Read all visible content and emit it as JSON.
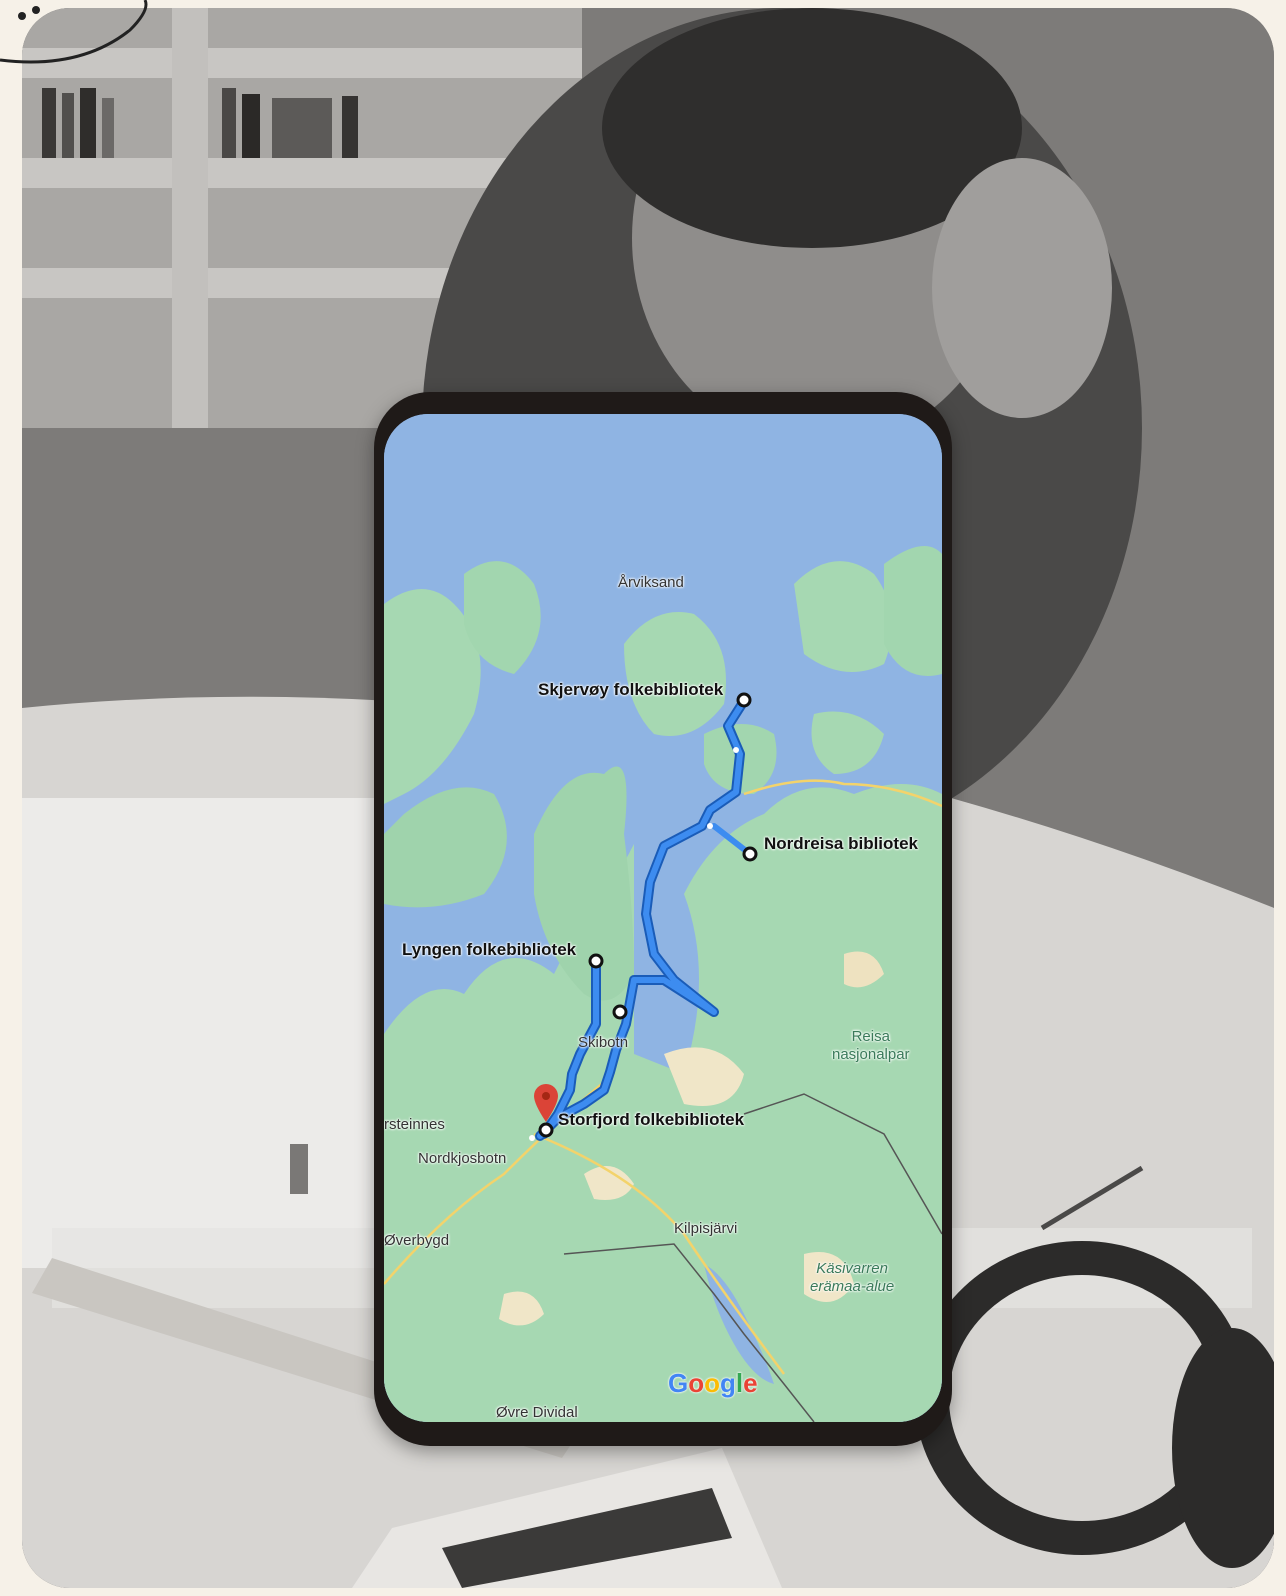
{
  "map": {
    "libraries": [
      {
        "id": "skjervoy",
        "label": "Skjervøy folkebibliotek"
      },
      {
        "id": "nordreisa",
        "label": "Nordreisa bibliotek"
      },
      {
        "id": "lyngen",
        "label": "Lyngen folkebibliotek"
      },
      {
        "id": "storfjord",
        "label": "Storfjord folkebibliotek"
      }
    ],
    "places": {
      "arviksand": "Årviksand",
      "skibotn": "Skibotn",
      "olderdalen_partial": "rsteinnes",
      "nordkjosbotn": "Nordkjosbotn",
      "overbygd": "Øverbygd",
      "kilpisjarvi": "Kilpisjärvi",
      "ovre_dividal": "Øvre Dividal"
    },
    "parks": {
      "reisa_line1": "Reisa",
      "reisa_line2": "nasjonalpar",
      "kasivarren_line1": "Käsivarren",
      "kasivarren_line2": "erämaa-alue"
    },
    "attribution": {
      "letters": [
        "G",
        "o",
        "o",
        "g",
        "l",
        "e"
      ],
      "colors": [
        "#4285F4",
        "#EA4335",
        "#FBBC05",
        "#4285F4",
        "#34A853",
        "#EA4335"
      ]
    },
    "colors": {
      "water": "#8fb4e3",
      "land": "#a8dab5",
      "route": "#1a73e8",
      "marker": "#db4437"
    }
  }
}
